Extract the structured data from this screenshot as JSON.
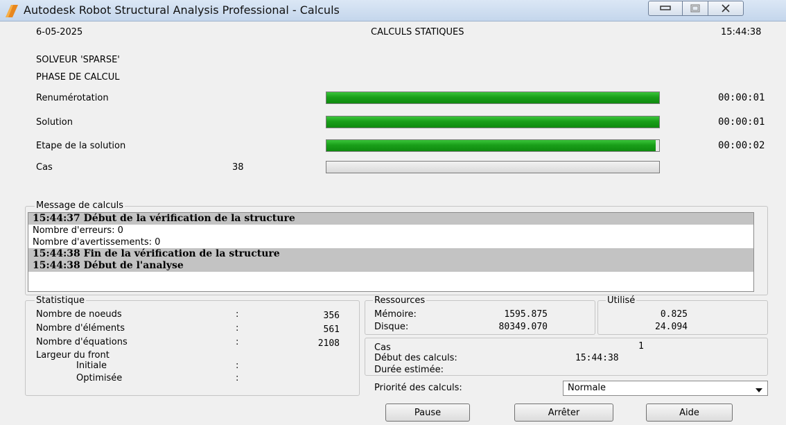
{
  "window": {
    "title": "Autodesk Robot Structural Analysis Professional - Calculs",
    "minimize_icon": "minimize-icon",
    "maximize_icon": "maximize-icon",
    "close_icon": "close-icon"
  },
  "header": {
    "date": "6-05-2025",
    "heading": "CALCULS STATIQUES",
    "time": "15:44:38",
    "solver": "SOLVEUR 'SPARSE'",
    "phase": "PHASE DE CALCUL"
  },
  "progress": [
    {
      "label": "Renumérotation",
      "fraction": 1.0,
      "time": "00:00:01",
      "count": ""
    },
    {
      "label": "Solution",
      "fraction": 1.0,
      "time": "00:00:01",
      "count": ""
    },
    {
      "label": "Etape de la solution",
      "fraction": 0.99,
      "time": "00:00:02",
      "count": ""
    },
    {
      "label": "Cas",
      "fraction": 0.0,
      "time": "",
      "count": "38"
    }
  ],
  "messages": {
    "legend": "Message de calculs",
    "lines": [
      {
        "text": "15:44:37  Début de la vérification de la structure",
        "highlight": true
      },
      {
        "text": "Nombre d'erreurs: 0",
        "highlight": false
      },
      {
        "text": "Nombre d'avertissements: 0",
        "highlight": false
      },
      {
        "text": "15:44:38  Fin de la vérification de la structure",
        "highlight": true
      },
      {
        "text": "15:44:38  Début de l'analyse",
        "highlight": true
      }
    ]
  },
  "statistique": {
    "legend": "Statistique",
    "rows": [
      {
        "label": "Nombre de noeuds",
        "sep": ":",
        "value": "356"
      },
      {
        "label": "Nombre d'éléments",
        "sep": ":",
        "value": "561"
      },
      {
        "label": "Nombre d'équations",
        "sep": ":",
        "value": "2108"
      }
    ],
    "front_label": "Largeur du front",
    "initiale_label": "Initiale",
    "initiale_sep": ":",
    "optimisee_label": "Optimisée",
    "optimisee_sep": ":"
  },
  "ressources": {
    "legend": "Ressources",
    "utilise_legend": "Utilisé",
    "rows": [
      {
        "label": "Mémoire:",
        "value": "1595.875",
        "used": "0.825"
      },
      {
        "label": "Disque:",
        "value": "80349.070",
        "used": "24.094"
      }
    ]
  },
  "calcul": {
    "cas_label": "Cas",
    "cas_value": "1",
    "debut_label": "Début des calculs:",
    "debut_value": "15:44:38",
    "duree_label": "Durée estimée:"
  },
  "priority": {
    "label": "Priorité des calculs:",
    "selected": "Normale",
    "dropdown_icon": "dropdown-arrow-icon"
  },
  "buttons": {
    "pause": "Pause",
    "stop": "Arrêter",
    "help": "Aide"
  },
  "colors": {
    "progress_green": "#1a9f1a",
    "highlight_row": "#c3c3c3"
  }
}
